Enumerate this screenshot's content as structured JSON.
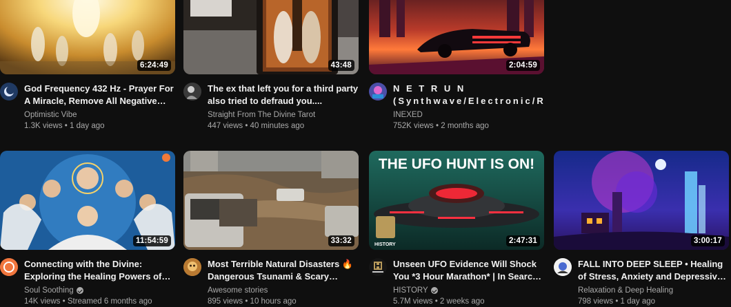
{
  "videos": [
    {
      "title": "God Frequency 432 Hz - Prayer For A Miracle, Remove All Negative Energy",
      "channel": "Optimistic Vibe",
      "stats": "1.3K views • 1 day ago",
      "duration": "6:24:49",
      "verified": false
    },
    {
      "title": "The ex that left you for a third party also tried to defraud you....",
      "channel": "Straight From The Divine Tarot",
      "stats": "447 views • 40 minutes ago",
      "duration": "43:48",
      "verified": false
    },
    {
      "title": "N E T R U N (Synthwave/Electronic/Retrowave)",
      "channel": "INEXED",
      "stats": "752K views • 2 months ago",
      "duration": "2:04:59",
      "verified": false
    },
    {
      "title": "Connecting with the Divine: Exploring the Healing Powers of Archangels",
      "channel": "Soul Soothing",
      "stats": "14K views • Streamed 6 months ago",
      "duration": "11:54:59",
      "verified": true
    },
    {
      "title": "Most Terrible Natural Disasters 🔥Dangerous Tsunami & Scary Floods",
      "channel": "Awesome stories",
      "stats": "895 views • 10 hours ago",
      "duration": "33:32",
      "verified": false
    },
    {
      "title": "Unseen UFO Evidence Will Shock You *3 Hour Marathon* | In Search Of",
      "channel": "HISTORY",
      "stats": "5.7M views • 2 weeks ago",
      "duration": "2:47:31",
      "verified": true
    },
    {
      "title": "FALL INTO DEEP SLEEP • Healing of Stress, Anxiety and Depressive States",
      "channel": "Relaxation & Deep Healing",
      "stats": "798 views • 1 day ago",
      "duration": "3:00:17",
      "verified": false
    }
  ],
  "thumb_text": {
    "ufo_headline": "THE UFO HUNT IS ON!",
    "history_logo": "HISTORY"
  },
  "colors": {
    "background": "#0f0f0f",
    "primary_text": "#f1f1f1",
    "secondary_text": "#aaaaaa"
  }
}
